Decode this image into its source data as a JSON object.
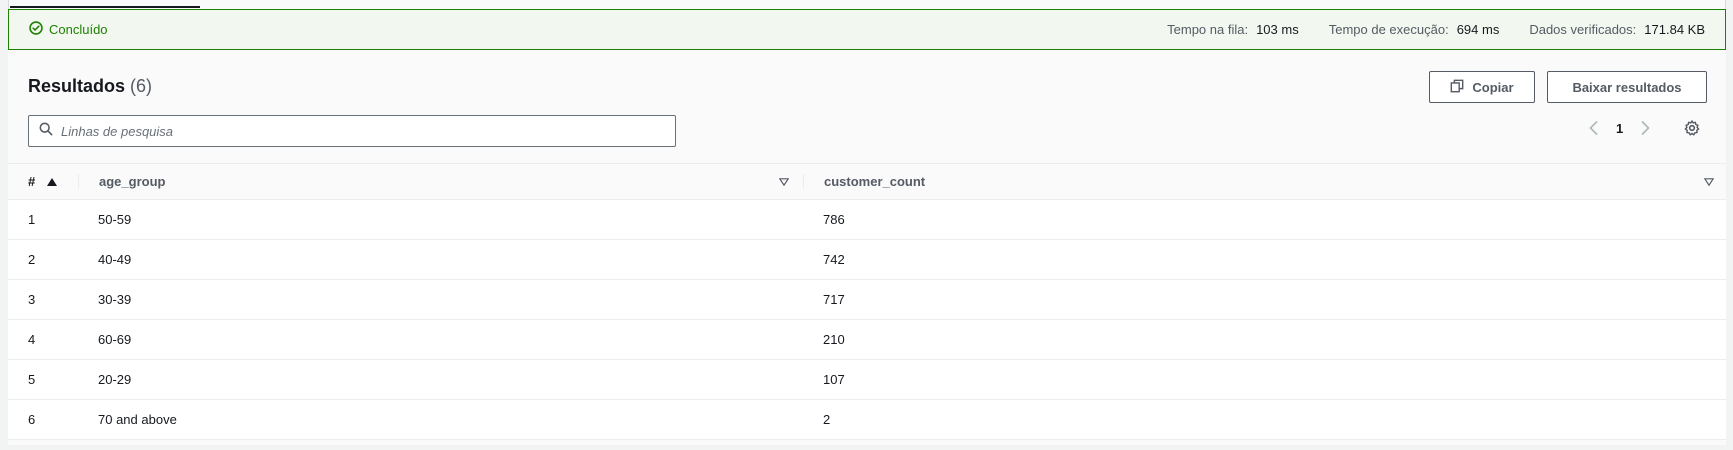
{
  "status": {
    "label": "Concluído",
    "metrics": [
      {
        "label": "Tempo na fila:",
        "value": "103 ms"
      },
      {
        "label": "Tempo de execução:",
        "value": "694 ms"
      },
      {
        "label": "Dados verificados:",
        "value": "171.84 KB"
      }
    ]
  },
  "results": {
    "title": "Resultados",
    "count": "(6)",
    "copy_label": "Copiar",
    "download_label": "Baixar resultados",
    "search_placeholder": "Linhas de pesquisa",
    "page": "1"
  },
  "table": {
    "headers": {
      "idx": "#",
      "age_group": "age_group",
      "customer_count": "customer_count"
    },
    "rows": [
      {
        "idx": "1",
        "age_group": "50-59",
        "customer_count": "786"
      },
      {
        "idx": "2",
        "age_group": "40-49",
        "customer_count": "742"
      },
      {
        "idx": "3",
        "age_group": "30-39",
        "customer_count": "717"
      },
      {
        "idx": "4",
        "age_group": "60-69",
        "customer_count": "210"
      },
      {
        "idx": "5",
        "age_group": "20-29",
        "customer_count": "107"
      },
      {
        "idx": "6",
        "age_group": "70 and above",
        "customer_count": "2"
      }
    ]
  },
  "colors": {
    "success": "#1d8102",
    "text": "#16191f",
    "muted": "#545b64"
  },
  "icons": [
    "check-circle-icon",
    "copy-icon",
    "search-icon",
    "chevron-left-icon",
    "chevron-right-icon",
    "settings-icon",
    "sort-ascending-icon",
    "filter-icon"
  ]
}
